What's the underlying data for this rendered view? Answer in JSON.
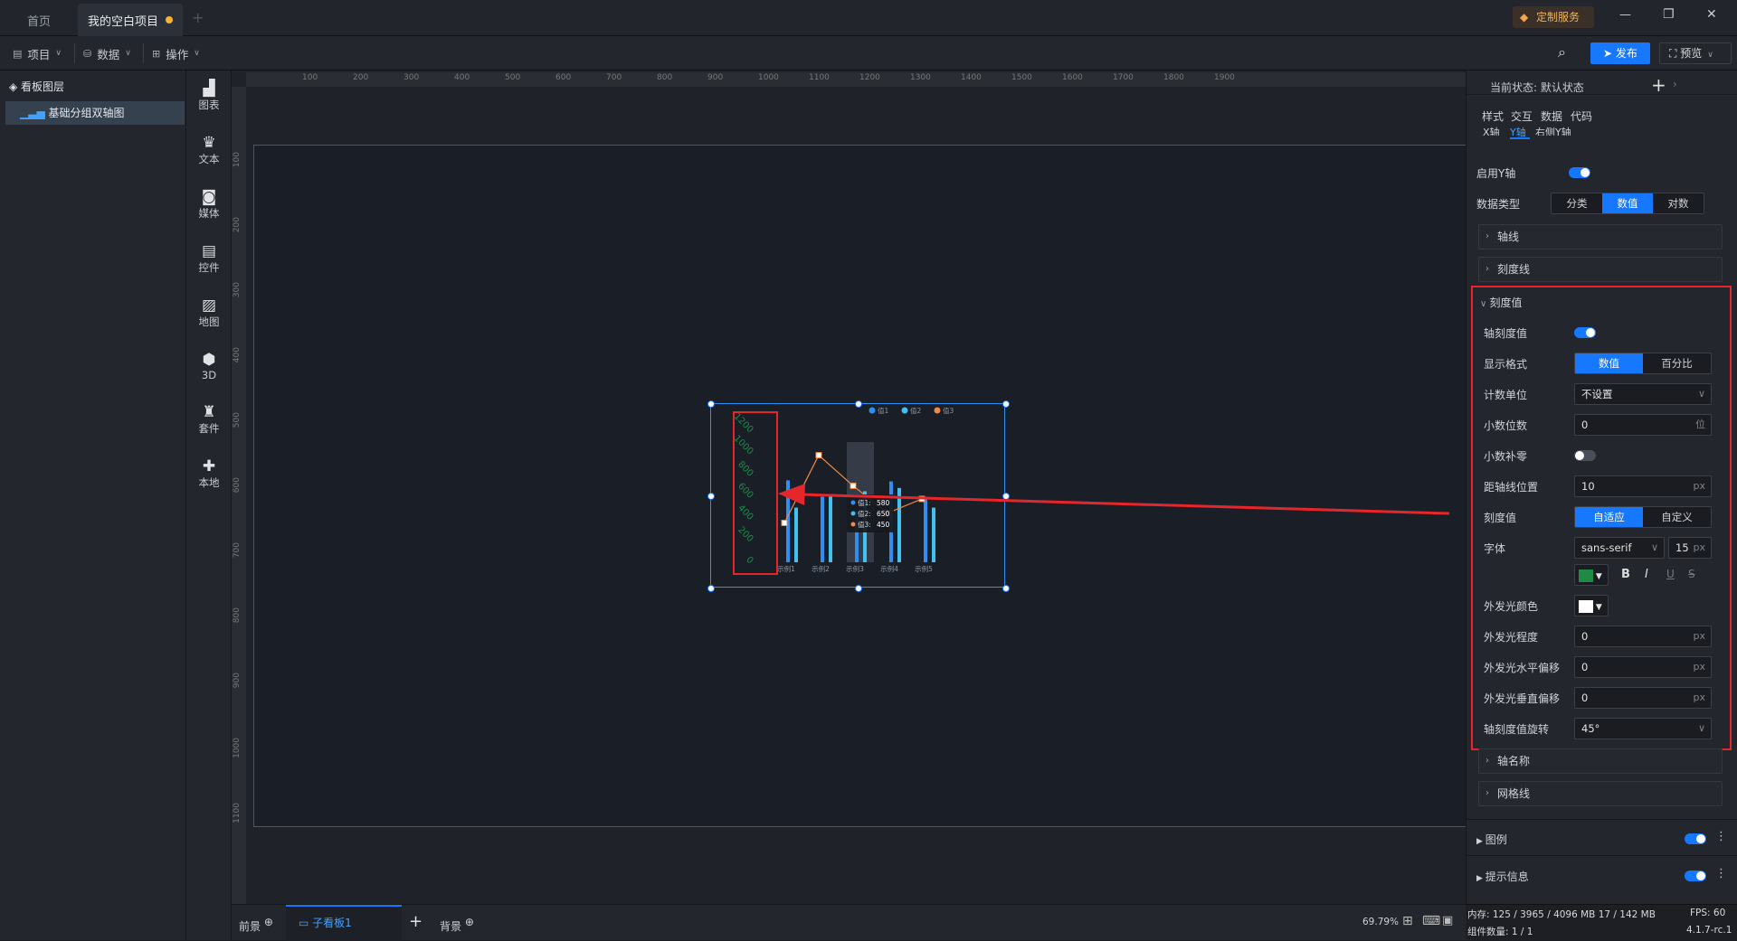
{
  "tabs": [
    {
      "label": "首页"
    },
    {
      "label": "我的空白项目"
    }
  ],
  "titlebar": {
    "custom_service": "定制服务",
    "minimize": "—",
    "restore": "❐",
    "close": "✕"
  },
  "menubar": {
    "project": "项目",
    "data": "数据",
    "operation": "操作",
    "publish": "发布",
    "preview": "预览"
  },
  "layers": {
    "title": "看板图层",
    "items": [
      {
        "label": "基础分组双轴图"
      }
    ]
  },
  "components": [
    {
      "label": "图表",
      "icon": "chart-icon"
    },
    {
      "label": "文本",
      "icon": "text-icon"
    },
    {
      "label": "媒体",
      "icon": "media-icon"
    },
    {
      "label": "控件",
      "icon": "control-icon"
    },
    {
      "label": "地图",
      "icon": "map-icon"
    },
    {
      "label": "3D",
      "icon": "cube-icon"
    },
    {
      "label": "套件",
      "icon": "suite-icon"
    },
    {
      "label": "本地",
      "icon": "puzzle-icon"
    }
  ],
  "ruler": {
    "h_ticks": [
      "100",
      "200",
      "300",
      "400",
      "500",
      "600",
      "700",
      "800",
      "900",
      "1000",
      "1100",
      "1200",
      "1300",
      "1400",
      "1500",
      "1600",
      "1700",
      "1800",
      "1900"
    ],
    "v_ticks": [
      "100",
      "200",
      "300",
      "400",
      "500",
      "600",
      "700",
      "800",
      "900",
      "1000",
      "1100"
    ]
  },
  "chart": {
    "legend": [
      "值1",
      "值2",
      "值3"
    ],
    "y_ticks": [
      "1200",
      "1000",
      "800",
      "600",
      "400",
      "200",
      "0"
    ],
    "x_ticks": [
      "示例1",
      "示例2",
      "示例3",
      "示例4",
      "示例5"
    ],
    "tooltip": [
      {
        "name": "值1:",
        "value": "580"
      },
      {
        "name": "值2:",
        "value": "650"
      },
      {
        "name": "值3:",
        "value": "450"
      }
    ]
  },
  "chart_data": {
    "type": "bar",
    "categories": [
      "示例1",
      "示例2",
      "示例3",
      "示例4",
      "示例5"
    ],
    "series": [
      {
        "name": "值1",
        "type": "bar",
        "values": [
          750,
          600,
          470,
          740,
          600
        ]
      },
      {
        "name": "值2",
        "type": "bar",
        "values": [
          500,
          620,
          650,
          680,
          500
        ]
      },
      {
        "name": "值3",
        "type": "line",
        "values": [
          360,
          980,
          700,
          450,
          580
        ]
      }
    ],
    "ylim": [
      0,
      1200
    ],
    "y_ticks": [
      0,
      200,
      400,
      600,
      800,
      1000,
      1200
    ],
    "legend": "top-right",
    "colors": [
      "#2f8ff0",
      "#41c1ef",
      "#f08a47"
    ]
  },
  "bottombar": {
    "front": "前景",
    "sub_board": "子看板1",
    "add": "+",
    "background": "背景",
    "zoom": "69.79%"
  },
  "right": {
    "state_label": "当前状态:",
    "state_value": "默认状态",
    "tabs": [
      "样式",
      "交互",
      "数据",
      "代码"
    ],
    "subtabs": [
      "X轴",
      "Y轴",
      "右侧Y轴"
    ],
    "enable_y": "启用Y轴",
    "data_type": "数据类型",
    "data_type_opts": [
      "分类",
      "数值",
      "对数"
    ],
    "axis_line": "轴线",
    "tick_line": "刻度线",
    "tick_value_section": "刻度值",
    "axis_tick_value": "轴刻度值",
    "display_format": "显示格式",
    "display_format_opts": [
      "数值",
      "百分比"
    ],
    "count_unit": "计数单位",
    "count_unit_value": "不设置",
    "decimals": "小数位数",
    "decimals_value": "0",
    "decimals_unit": "位",
    "decimal_pad": "小数补零",
    "distance": "距轴线位置",
    "distance_value": "10",
    "px": "px",
    "tick_value": "刻度值",
    "tick_value_opts": [
      "自适应",
      "自定义"
    ],
    "font": "字体",
    "font_family": "sans-serif",
    "font_size": "15",
    "font_color": "#1f8a46",
    "bold": "B",
    "italic": "I",
    "underline": "U",
    "strike": "S",
    "glow_color": "外发光颜色",
    "glow_level": "外发光程度",
    "glow_level_value": "0",
    "glow_h": "外发光水平偏移",
    "glow_h_value": "0",
    "glow_v": "外发光垂直偏移",
    "glow_v_value": "0",
    "rotate": "轴刻度值旋转",
    "rotate_value": "45°",
    "axis_name": "轴名称",
    "grid_line": "网格线",
    "legend": "图例",
    "tooltip": "提示信息"
  },
  "status": {
    "memory": "内存: 125 / 3965 / 4096 MB  17 / 142 MB",
    "fps": "FPS: 60",
    "components": "组件数量: 1 / 1",
    "version": "4.1.7-rc.1"
  }
}
